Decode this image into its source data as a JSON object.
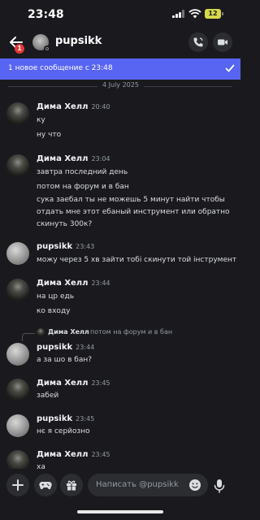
{
  "status_bar": {
    "time": "23:48",
    "battery": "12"
  },
  "header": {
    "title": "pupsikk",
    "unread_badge": "1",
    "chevron": "›"
  },
  "banner": {
    "text": "1 новое сообщение с 23:48"
  },
  "date_divider": "4 July 2025",
  "messages": [
    {
      "author": "Дима Хелл",
      "time": "20:40",
      "lines": [
        "ку",
        "ну что"
      ]
    },
    {
      "author": "Дима Хелл",
      "time": "23:04",
      "lines": [
        "завтра последний день",
        "потом на форум и в бан",
        "сука заебал ты не можешь 5 минут найти чтобы",
        "отдать мне этот ебаный инструмент или обратно",
        "скинуть 300к?"
      ]
    },
    {
      "author": "pupsikk",
      "time": "23:43",
      "lines": [
        "можу через 5 хв зайти тобі скинути той інструмент"
      ]
    },
    {
      "author": "Дима Хелл",
      "time": "23:44",
      "lines": [
        "на цр едь",
        "ко входу"
      ]
    },
    {
      "author": "pupsikk",
      "time": "23:44",
      "lines": [
        "а за шо в бан?"
      ],
      "reply": {
        "author": "Дима Хелл",
        "text": "потом на форум и в бан"
      }
    },
    {
      "author": "Дима Хелл",
      "time": "23:45",
      "lines": [
        "забей"
      ]
    },
    {
      "author": "pupsikk",
      "time": "23:45",
      "lines": [
        "нє я серйозно"
      ]
    },
    {
      "author": "Дима Хелл",
      "time": "23:45",
      "lines": [
        "ха"
      ]
    }
  ],
  "composer": {
    "placeholder": "Написать @pupsikk"
  },
  "icons": [
    "back-arrow-icon",
    "phone-icon",
    "video-icon",
    "check-icon",
    "plus-icon",
    "gamepad-icon",
    "gift-icon",
    "emoji-icon",
    "mic-icon"
  ],
  "colors": {
    "background": "#1a1a1e",
    "accent": "#5865f2",
    "badge": "#e53935",
    "battery": "#d6d84a"
  }
}
